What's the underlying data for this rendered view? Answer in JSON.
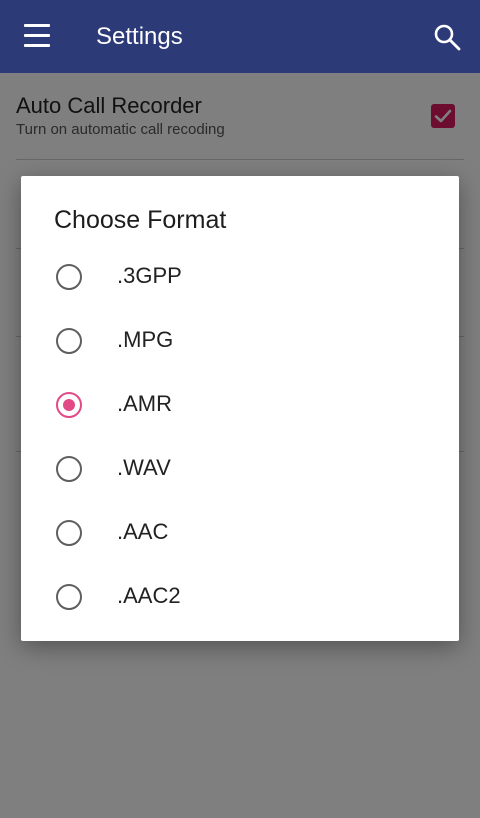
{
  "appbar": {
    "title": "Settings",
    "menu_icon": "hamburger-menu-icon",
    "search_icon": "search-icon",
    "background": "#2c3a78"
  },
  "preferences": [
    {
      "title": "Auto Call Recorder",
      "summary": "Turn on automatic call recoding",
      "checked": true
    }
  ],
  "dialog": {
    "title": "Choose Format",
    "options": [
      {
        "label": ".3GPP",
        "selected": false
      },
      {
        "label": ".MPG",
        "selected": false
      },
      {
        "label": ".AMR",
        "selected": true
      },
      {
        "label": ".WAV",
        "selected": false
      },
      {
        "label": ".AAC",
        "selected": false
      },
      {
        "label": ".AAC2",
        "selected": false
      }
    ]
  },
  "colors": {
    "accent": "#e24a86",
    "checkbox": "#d81b60"
  }
}
